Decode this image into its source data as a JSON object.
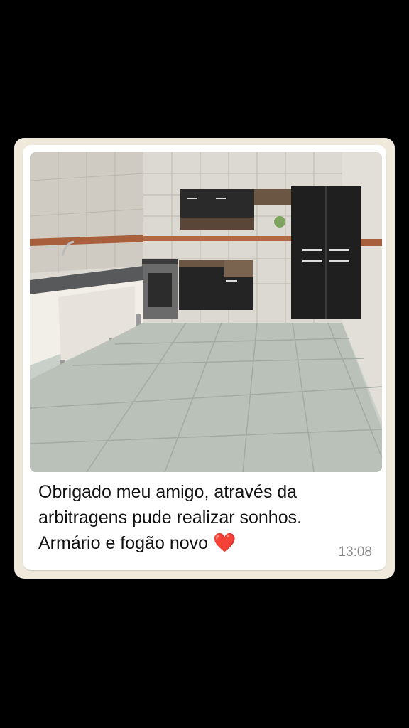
{
  "message": {
    "line1": "Obrigado meu amigo, através da",
    "line2": "arbitragens pude realizar sonhos.",
    "line3": "Armário e fogão novo",
    "emoji": "❤️",
    "time": "13:08"
  },
  "colors": {
    "screen_background": "#000000",
    "chat_background": "#efe9dc",
    "bubble_background": "#ffffff",
    "timestamp": "#8a8a8a"
  },
  "image": {
    "subject": "kitchen-photo",
    "icons": [
      "heart-emoji-icon"
    ]
  }
}
